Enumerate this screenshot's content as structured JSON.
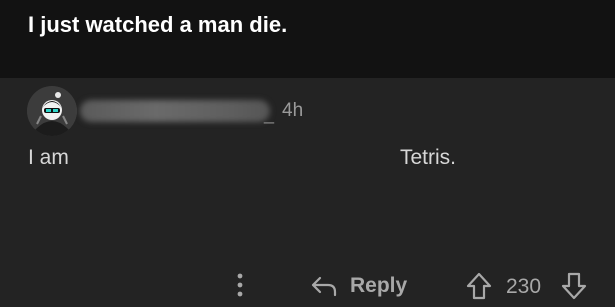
{
  "post": {
    "title": "I just watched a man die."
  },
  "comment": {
    "username_visible_tail": "_",
    "age": "4h",
    "body_left": "I am",
    "body_right": "Tetris.",
    "avatar_icon": "avatar-image"
  },
  "actions": {
    "more_icon": "more-vertical-icon",
    "reply_icon": "reply-arrow-icon",
    "reply_label": "Reply",
    "upvote_icon": "upvote-arrow-icon",
    "score": "230",
    "downvote_icon": "downvote-arrow-icon"
  },
  "colors": {
    "background": "#232323",
    "header_background": "#121212",
    "title_text": "#ffffff",
    "body_text": "#d7d7d7",
    "muted_text": "#a8a8a8"
  }
}
